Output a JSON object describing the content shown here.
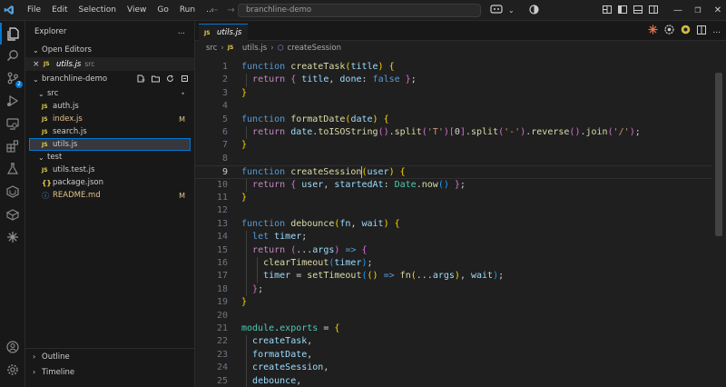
{
  "titlebar": {
    "menu": [
      "File",
      "Edit",
      "Selection",
      "View",
      "Go",
      "Run",
      "..."
    ],
    "command_center": "branchline-demo",
    "window_controls": [
      "minimize-icon",
      "restore-icon",
      "close-icon"
    ]
  },
  "activity_bar": {
    "items": [
      "explorer-icon",
      "search-icon",
      "source-control-icon",
      "run-debug-icon",
      "remote-explorer-icon",
      "extensions-icon",
      "testing-icon",
      "deploy-icon",
      "containers-icon",
      "ai-icon"
    ],
    "scm_badge": "2",
    "bottom": [
      "account-icon",
      "settings-gear-icon"
    ]
  },
  "sidebar": {
    "title": "Explorer",
    "more": "...",
    "open_editors_label": "Open Editors",
    "open_editor": {
      "name": "utils.js",
      "dir": "src",
      "close": "×"
    },
    "project_label": "branchline-demo",
    "tree": [
      {
        "kind": "folder",
        "name": "src",
        "deco": "•"
      },
      {
        "kind": "js",
        "name": "auth.js",
        "deco": ""
      },
      {
        "kind": "js",
        "name": "index.js",
        "deco": "M"
      },
      {
        "kind": "js",
        "name": "search.js",
        "deco": ""
      },
      {
        "kind": "js",
        "name": "utils.js",
        "deco": "",
        "selected": true
      },
      {
        "kind": "folder",
        "name": "test",
        "deco": ""
      },
      {
        "kind": "js",
        "name": "utils.test.js",
        "deco": ""
      },
      {
        "kind": "json",
        "name": "package.json",
        "deco": ""
      },
      {
        "kind": "info",
        "name": "README.md",
        "deco": "M"
      }
    ],
    "outline_label": "Outline",
    "timeline_label": "Timeline"
  },
  "editor": {
    "tab": {
      "icon": "JS",
      "name": "utils.js"
    },
    "breadcrumb": {
      "folder": "src",
      "sep": "›",
      "file": "utils.js",
      "symbol": "createSession"
    },
    "current_line": 9,
    "lines": [
      [
        [
          "kw2",
          "function "
        ],
        [
          "fn",
          "createTask"
        ],
        [
          "br1",
          "("
        ],
        [
          "var",
          "title"
        ],
        [
          "br1",
          ")"
        ],
        [
          "pn",
          " "
        ],
        [
          "br1",
          "{"
        ]
      ],
      [
        [
          "pn",
          "  "
        ],
        [
          "kw",
          "return "
        ],
        [
          "br2",
          "{ "
        ],
        [
          "var",
          "title"
        ],
        [
          "pn",
          ", "
        ],
        [
          "var",
          "done"
        ],
        [
          "pn",
          ": "
        ],
        [
          "kw2",
          "false"
        ],
        [
          "br2",
          " }"
        ],
        [
          "pn",
          ";"
        ]
      ],
      [
        [
          "br1",
          "}"
        ]
      ],
      [],
      [
        [
          "kw2",
          "function "
        ],
        [
          "fn",
          "formatDate"
        ],
        [
          "br1",
          "("
        ],
        [
          "var",
          "date"
        ],
        [
          "br1",
          ")"
        ],
        [
          "pn",
          " "
        ],
        [
          "br1",
          "{"
        ]
      ],
      [
        [
          "pn",
          "  "
        ],
        [
          "kw",
          "return "
        ],
        [
          "var",
          "date"
        ],
        [
          "pn",
          "."
        ],
        [
          "fn",
          "toISOString"
        ],
        [
          "br2",
          "()"
        ],
        [
          "pn",
          "."
        ],
        [
          "fn",
          "split"
        ],
        [
          "br2",
          "("
        ],
        [
          "str",
          "'T'"
        ],
        [
          "br2",
          ")"
        ],
        [
          "br2",
          "["
        ],
        [
          "pn",
          "0"
        ],
        [
          "br2",
          "]"
        ],
        [
          "pn",
          "."
        ],
        [
          "fn",
          "split"
        ],
        [
          "br2",
          "("
        ],
        [
          "str",
          "'-'"
        ],
        [
          "br2",
          ")"
        ],
        [
          "pn",
          "."
        ],
        [
          "fn",
          "reverse"
        ],
        [
          "br2",
          "()"
        ],
        [
          "pn",
          "."
        ],
        [
          "fn",
          "join"
        ],
        [
          "br2",
          "("
        ],
        [
          "str",
          "'/'"
        ],
        [
          "br2",
          ")"
        ],
        [
          "pn",
          ";"
        ]
      ],
      [
        [
          "br1",
          "}"
        ]
      ],
      [],
      [
        [
          "kw2",
          "function "
        ],
        [
          "fn",
          "createSession"
        ],
        [
          "br1",
          "("
        ],
        [
          "var",
          "user"
        ],
        [
          "br1",
          ")"
        ],
        [
          "pn",
          " "
        ],
        [
          "br1",
          "{"
        ]
      ],
      [
        [
          "pn",
          "  "
        ],
        [
          "kw",
          "return "
        ],
        [
          "br2",
          "{ "
        ],
        [
          "var",
          "user"
        ],
        [
          "pn",
          ", "
        ],
        [
          "var",
          "startedAt"
        ],
        [
          "pn",
          ": "
        ],
        [
          "cls",
          "Date"
        ],
        [
          "pn",
          "."
        ],
        [
          "fn",
          "now"
        ],
        [
          "br3",
          "()"
        ],
        [
          "br2",
          " }"
        ],
        [
          "pn",
          ";"
        ]
      ],
      [
        [
          "br1",
          "}"
        ]
      ],
      [],
      [
        [
          "kw2",
          "function "
        ],
        [
          "fn",
          "debounce"
        ],
        [
          "br1",
          "("
        ],
        [
          "var",
          "fn"
        ],
        [
          "pn",
          ", "
        ],
        [
          "var",
          "wait"
        ],
        [
          "br1",
          ")"
        ],
        [
          "pn",
          " "
        ],
        [
          "br1",
          "{"
        ]
      ],
      [
        [
          "pn",
          "  "
        ],
        [
          "kw2",
          "let "
        ],
        [
          "var",
          "timer"
        ],
        [
          "pn",
          ";"
        ]
      ],
      [
        [
          "pn",
          "  "
        ],
        [
          "kw",
          "return "
        ],
        [
          "br2",
          "("
        ],
        [
          "pn",
          "..."
        ],
        [
          "var",
          "args"
        ],
        [
          "br2",
          ")"
        ],
        [
          "pn",
          " "
        ],
        [
          "kw2",
          "=>"
        ],
        [
          "pn",
          " "
        ],
        [
          "br2",
          "{"
        ]
      ],
      [
        [
          "pn",
          "    "
        ],
        [
          "fn",
          "clearTimeout"
        ],
        [
          "br3",
          "("
        ],
        [
          "var",
          "timer"
        ],
        [
          "br3",
          ")"
        ],
        [
          "pn",
          ";"
        ]
      ],
      [
        [
          "pn",
          "    "
        ],
        [
          "var",
          "timer"
        ],
        [
          "pn",
          " = "
        ],
        [
          "fn",
          "setTimeout"
        ],
        [
          "br3",
          "("
        ],
        [
          "br1",
          "()"
        ],
        [
          "pn",
          " "
        ],
        [
          "kw2",
          "=>"
        ],
        [
          "pn",
          " "
        ],
        [
          "fn",
          "fn"
        ],
        [
          "br1",
          "("
        ],
        [
          "pn",
          "..."
        ],
        [
          "var",
          "args"
        ],
        [
          "br1",
          ")"
        ],
        [
          "pn",
          ", "
        ],
        [
          "var",
          "wait"
        ],
        [
          "br3",
          ")"
        ],
        [
          "pn",
          ";"
        ]
      ],
      [
        [
          "pn",
          "  "
        ],
        [
          "br2",
          "}"
        ],
        [
          "pn",
          ";"
        ]
      ],
      [
        [
          "br1",
          "}"
        ]
      ],
      [],
      [
        [
          "cls",
          "module"
        ],
        [
          "pn",
          "."
        ],
        [
          "cls",
          "exports"
        ],
        [
          "pn",
          " = "
        ],
        [
          "br1",
          "{"
        ]
      ],
      [
        [
          "pn",
          "  "
        ],
        [
          "var",
          "createTask"
        ],
        [
          "pn",
          ","
        ]
      ],
      [
        [
          "pn",
          "  "
        ],
        [
          "var",
          "formatDate"
        ],
        [
          "pn",
          ","
        ]
      ],
      [
        [
          "pn",
          "  "
        ],
        [
          "var",
          "createSession"
        ],
        [
          "pn",
          ","
        ]
      ],
      [
        [
          "pn",
          "  "
        ],
        [
          "var",
          "debounce"
        ],
        [
          "pn",
          ","
        ]
      ]
    ]
  },
  "colors": {
    "accent": "#0078d4",
    "modified": "#e2c08d",
    "editor_bg": "#1f1f1f",
    "chrome_bg": "#181818"
  }
}
